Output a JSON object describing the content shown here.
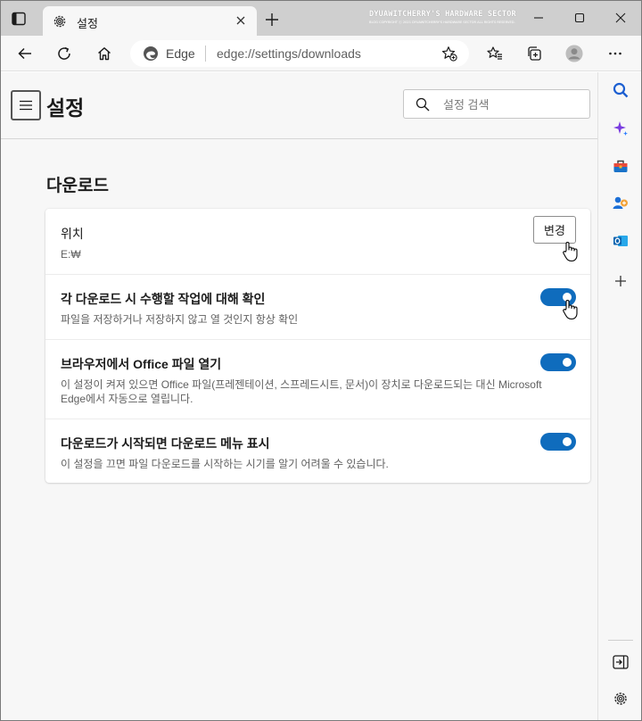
{
  "window": {
    "tab_title": "설정",
    "watermark_title": "DYUAWITCHERRY'S HARDWARE SECTOR",
    "watermark_sub": "BLOG COPYRIGHT ⓒ 2021 DYUAWITCHERRY'S HARDWARE SECTOR ALL RIGHTS RESERVED."
  },
  "toolbar": {
    "site_name": "Edge",
    "url": "edge://settings/downloads"
  },
  "header": {
    "title": "설정",
    "search_placeholder": "설정 검색"
  },
  "section": {
    "title": "다운로드"
  },
  "rows": [
    {
      "title": "위치",
      "description": "E:₩",
      "button_label": "변경"
    },
    {
      "title": "각 다운로드 시 수행할 작업에 대해 확인",
      "description": "파일을 저장하거나 저장하지 않고 열 것인지 항상 확인",
      "enabled": true
    },
    {
      "title": "브라우저에서 Office 파일 열기",
      "description": "이 설정이 켜져 있으면 Office 파일(프레젠테이션, 스프레드시트, 문서)이 장치로 다운로드되는 대신 Microsoft Edge에서 자동으로 열립니다.",
      "enabled": true
    },
    {
      "title": "다운로드가 시작되면 다운로드 메뉴 표시",
      "description": "이 설정을 끄면 파일 다운로드를 시작하는 시기를 알기 어려울 수 있습니다.",
      "enabled": true
    }
  ],
  "colors": {
    "accent": "#0f6cbd",
    "titlebar": "#cfcfcf",
    "content_bg": "#f7f7f7"
  },
  "icons": {
    "titlebar": [
      "tab-actions-icon",
      "gear-icon",
      "close-icon",
      "plus-icon",
      "minimize-icon",
      "maximize-icon",
      "close-icon"
    ],
    "toolbar": [
      "back-arrow-icon",
      "refresh-icon",
      "home-icon",
      "edge-logo-icon",
      "add-favorite-icon",
      "favorites-icon",
      "collections-icon",
      "profile-icon",
      "more-icon"
    ],
    "sidebar": [
      "search-icon",
      "sparkle-icon",
      "toolbox-icon",
      "people-icon",
      "outlook-icon",
      "plus-icon",
      "hide-sidebar-icon",
      "gear-icon"
    ]
  }
}
